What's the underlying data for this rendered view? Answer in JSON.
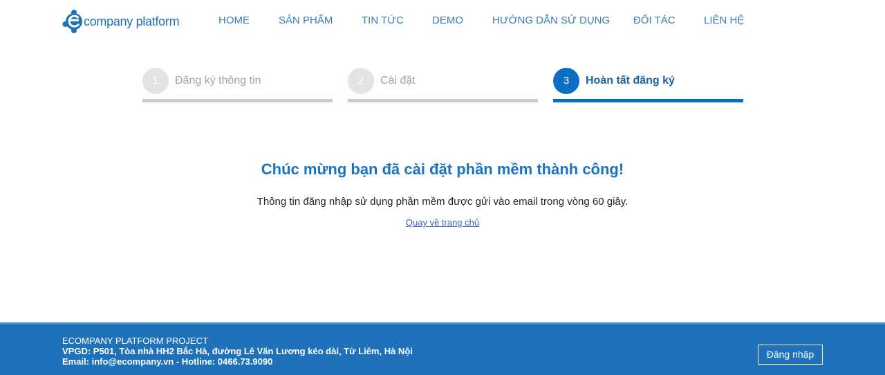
{
  "header": {
    "logo_text": "company platform",
    "logo_icon": "puzzle-e-icon",
    "nav": [
      {
        "label": "HOME"
      },
      {
        "label": "SẢN PHẨM"
      },
      {
        "label": "TIN TỨC"
      },
      {
        "label": "DEMO"
      },
      {
        "label": "HƯỚNG DẪN SỬ DỤNG"
      },
      {
        "label": "ĐỐI TÁC"
      },
      {
        "label": "LIÊN HỆ"
      }
    ]
  },
  "steps": [
    {
      "number": "1",
      "label": "Đăng ký thông tin",
      "state": "done"
    },
    {
      "number": "2",
      "label": "Cài đặt",
      "state": "done"
    },
    {
      "number": "3",
      "label": "Hoàn tất đăng ký",
      "state": "active"
    }
  ],
  "main": {
    "title": "Chúc mừng bạn đã cài đặt phần mềm thành công!",
    "info": "Thông tin đăng nhập sử dụng phần mềm được gửi vào email trong vòng 60 giây.",
    "home_link": "Quay về trang chủ"
  },
  "footer": {
    "project": "ECOMPANY PLATFORM PROJECT",
    "address": "VPGD: P501, Tòa nhà HH2 Bắc Hà, đường Lê Văn Lương kéo dài, Từ Liêm, Hà Nội",
    "contact": "Email: info@ecompany.vn - Hotline: 0466.73.9090",
    "login_label": "Đăng nhập"
  },
  "colors": {
    "brand_blue": "#1f72ba",
    "active_step": "#0b6fc2",
    "inactive_step": "#cccccc",
    "nav_text": "#3a7bc0"
  }
}
